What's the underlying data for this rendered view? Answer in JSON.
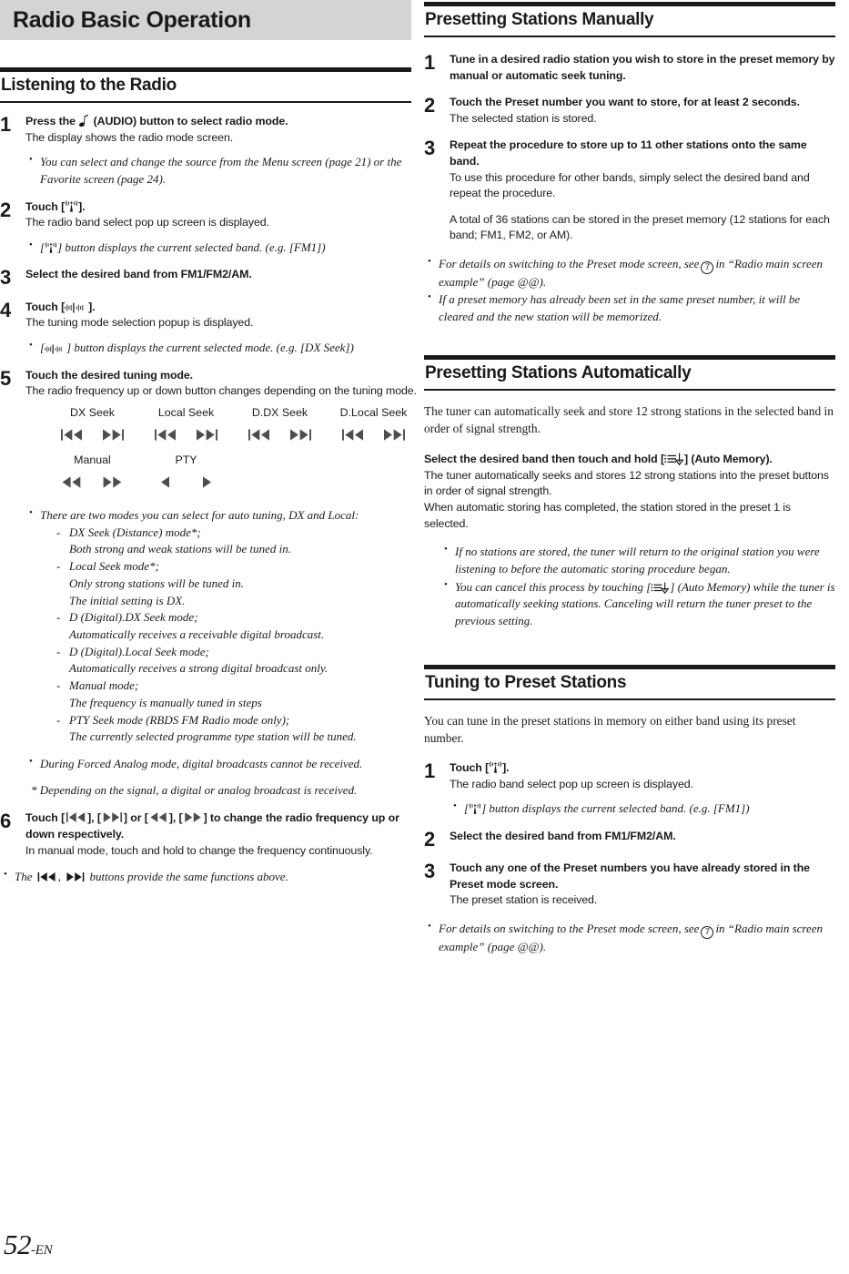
{
  "chapter": {
    "title": "Radio Basic Operation"
  },
  "footer": {
    "page": "52",
    "suffix": "-EN"
  },
  "left": {
    "section1": {
      "heading": "Listening to the Radio",
      "steps": [
        {
          "num": "1",
          "title_pre": "Press the",
          "title_post": "(AUDIO) button to select radio mode.",
          "desc": "The display shows the radio mode screen.",
          "notes": [
            "You can select and change the source from the Menu screen (page 21) or the Favorite screen (page 24)."
          ]
        },
        {
          "num": "2",
          "title_pre": "Touch [",
          "title_post": "].",
          "desc": "The radio band select pop up screen is displayed.",
          "note_pre": "[",
          "note_post": "] button displays the current selected band. (e.g. [FM1])"
        },
        {
          "num": "3",
          "title": "Select the desired band from FM1/FM2/AM."
        },
        {
          "num": "4",
          "title_pre": "Touch [",
          "title_post": "].",
          "desc": "The tuning mode selection popup is displayed.",
          "note_pre": "[",
          "note_post": "] button displays the current selected mode. (e.g. [DX Seek])"
        },
        {
          "num": "5",
          "title": "Touch the desired tuning mode.",
          "desc": "The radio frequency up or down button changes depending on the tuning mode."
        },
        {
          "num": "6",
          "title_a": "Touch [",
          "title_b": "], [",
          "title_c": "] or [",
          "title_d": "], [",
          "title_e": "] to change the radio frequency up or down respectively.",
          "desc": "In manual mode, touch and hold to change the frequency continuously."
        }
      ],
      "tuning_modes": [
        {
          "label": "DX Seek",
          "prev": "skip-prev-3",
          "next": "skip-next-3"
        },
        {
          "label": "Local Seek",
          "prev": "skip-prev-3",
          "next": "skip-next-3"
        },
        {
          "label": "D.DX Seek",
          "prev": "skip-prev-3",
          "next": "skip-next-3"
        },
        {
          "label": "D.Local Seek",
          "prev": "skip-prev-3",
          "next": "skip-next-3"
        },
        {
          "label": "Manual",
          "prev": "rewind-2",
          "next": "forward-2"
        },
        {
          "label": "PTY",
          "prev": "triangle-left",
          "next": "triangle-right"
        }
      ],
      "tuning_note_intro": "There are two modes you can select for auto tuning, DX and Local:",
      "tuning_mode_details": [
        "DX Seek (Distance) mode*;",
        "Both strong and weak stations will be tuned in.",
        "Local Seek mode*;",
        "Only strong stations will be tuned in.",
        "The initial setting is DX.",
        "D (Digital).DX Seek mode;",
        "Automatically receives a receivable digital broadcast.",
        "D (Digital).Local Seek mode;",
        "Automatically receives a strong digital broadcast only.",
        "Manual mode;",
        "The frequency is manually tuned in steps",
        "PTY Seek mode (RBDS FM Radio mode only);",
        "The currently selected programme type station will be tuned."
      ],
      "forced_analog_note": "During Forced Analog mode, digital broadcasts cannot be received.",
      "star_note": "* Depending on the signal, a digital or analog broadcast is received.",
      "final_note_pre": "The",
      "final_note_mid": ",",
      "final_note_post": "buttons provide the same functions above."
    }
  },
  "right": {
    "section_manual": {
      "heading": "Presetting Stations Manually",
      "steps": [
        {
          "num": "1",
          "title": "Tune in a desired radio station you wish to store in the preset memory by manual or automatic seek tuning."
        },
        {
          "num": "2",
          "title": "Touch the Preset number you want to store, for at least 2 seconds.",
          "desc": "The selected station is stored."
        },
        {
          "num": "3",
          "title": "Repeat the procedure to store up to 11 other stations onto the same band.",
          "desc": "To use this procedure for other bands, simply select the desired band and repeat the procedure.",
          "desc2": "A total of 36 stations can be stored in the preset memory (12 stations for each band; FM1, FM2, or AM)."
        }
      ],
      "notes": [
        {
          "pre": "For details on switching to the Preset mode screen, see",
          "circ": "7",
          "post": "in “Radio main screen example” (page @@)."
        },
        {
          "text": "If a preset memory has already been set in the same preset number, it will be cleared and the new station will be memorized."
        }
      ]
    },
    "section_auto": {
      "heading": "Presetting Stations Automatically",
      "intro": "The tuner can automatically seek and store 12 strong stations in the selected band in order of signal strength.",
      "action_pre": "Select the desired band then touch and hold [",
      "action_post": "] (Auto Memory).",
      "desc": "The tuner automatically seeks and stores 12 strong stations into the preset buttons in order of signal strength.",
      "desc2": "When automatic storing has completed, the station stored in the preset 1 is selected.",
      "notes": [
        {
          "text": "If no stations are stored, the tuner will return to the original station you were listening to before the automatic storing procedure began."
        },
        {
          "pre": "You can cancel this process by touching [",
          "mid": "] (Auto Memory) while the tuner is automatically seeking stations. Canceling will return the tuner preset to the previous setting."
        }
      ]
    },
    "section_preset": {
      "heading": "Tuning to Preset Stations",
      "intro": "You can tune in the preset stations in memory on either band using its preset number.",
      "steps": [
        {
          "num": "1",
          "title_pre": "Touch [",
          "title_post": "].",
          "desc": "The radio band select pop up screen is displayed.",
          "note_pre": "[",
          "note_post": "] button displays the current selected band. (e.g. [FM1])"
        },
        {
          "num": "2",
          "title": "Select the desired band from FM1/FM2/AM."
        },
        {
          "num": "3",
          "title": "Touch any one of the Preset numbers you have already stored in the Preset mode screen.",
          "desc": "The preset station is received."
        }
      ],
      "notes": [
        {
          "pre": "For details on switching to the Preset mode screen, see",
          "circ": "7",
          "post": "in “Radio main screen example” (page @@)."
        }
      ]
    }
  },
  "icons": {
    "audio": "music-note-icon",
    "band": "antenna-icon",
    "tuning": "signal-bars-icon",
    "auto_memory": "auto-memory-icon",
    "skip_prev": "skip-previous-icon",
    "skip_next": "skip-next-icon",
    "rewind": "rewind-icon",
    "forward": "fast-forward-icon"
  },
  "colors": {
    "banner_bg": "#d4d4d4",
    "rule": "#1a1a1a",
    "icon_gray": "#4d4d4d"
  }
}
